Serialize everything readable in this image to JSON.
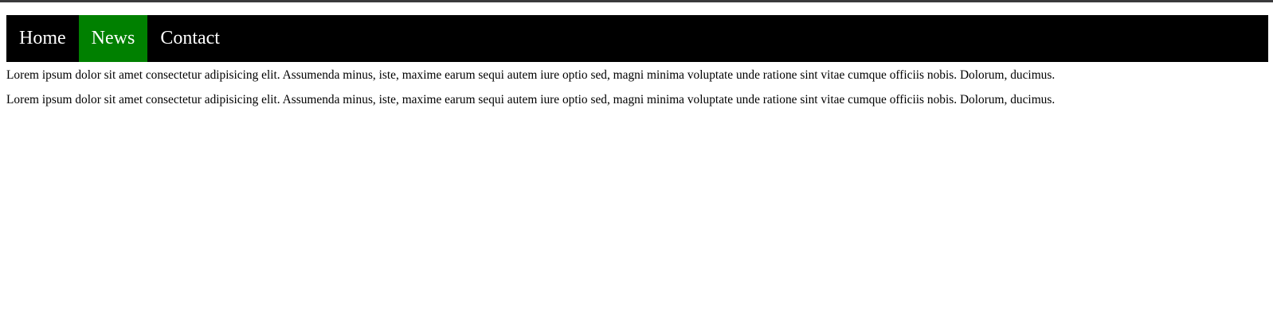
{
  "nav": {
    "items": [
      {
        "label": "Home",
        "active": false
      },
      {
        "label": "News",
        "active": true
      },
      {
        "label": "Contact",
        "active": false
      }
    ],
    "active_color": "#008000",
    "background_color": "#000000"
  },
  "content": {
    "paragraphs": [
      "Lorem ipsum dolor sit amet consectetur adipisicing elit. Assumenda minus, iste, maxime earum sequi autem iure optio sed, magni minima voluptate unde ratione sint vitae cumque officiis nobis. Dolorum, ducimus.",
      "Lorem ipsum dolor sit amet consectetur adipisicing elit. Assumenda minus, iste, maxime earum sequi autem iure optio sed, magni minima voluptate unde ratione sint vitae cumque officiis nobis. Dolorum, ducimus."
    ]
  }
}
